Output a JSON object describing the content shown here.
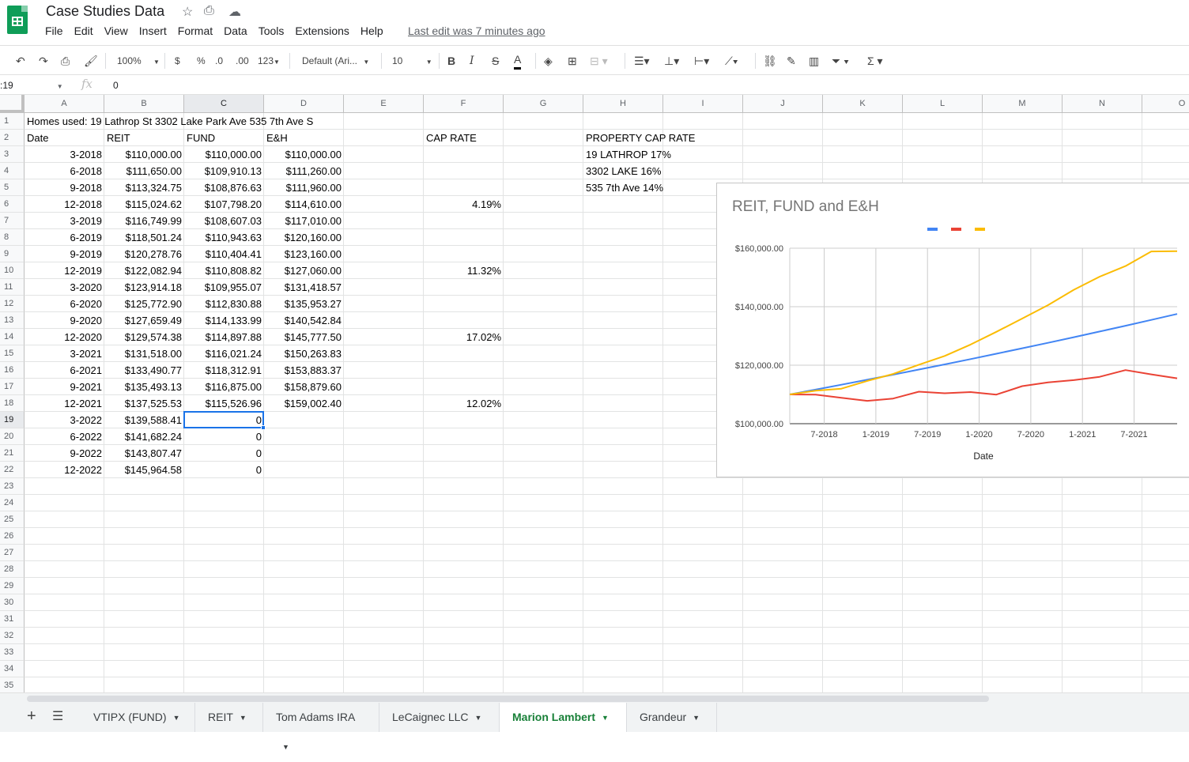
{
  "app": {
    "doc_title": "Case Studies Data",
    "menu": [
      "File",
      "Edit",
      "View",
      "Insert",
      "Format",
      "Data",
      "Tools",
      "Extensions",
      "Help"
    ],
    "last_edit": "Last edit was 7 minutes ago"
  },
  "toolbar": {
    "zoom": "100%",
    "currency": "$",
    "percent": "%",
    "decrease_decimal": ".0",
    "increase_decimal": ".00",
    "more_formats": "123",
    "font": "Default (Ari...",
    "font_size": "10",
    "bold": "B",
    "italic": "I",
    "strike": "S",
    "text_color": "A",
    "text_color_value": "#000000"
  },
  "formula_bar": {
    "name_box": ":19",
    "fx": "fx",
    "value": "0"
  },
  "columns": [
    "A",
    "B",
    "C",
    "D",
    "E",
    "F",
    "G",
    "H",
    "I",
    "J",
    "K",
    "L",
    "M",
    "N",
    "O"
  ],
  "rows": [
    "1",
    "2",
    "3",
    "4",
    "5",
    "6",
    "7",
    "8",
    "9",
    "10",
    "11",
    "12",
    "13",
    "14",
    "15",
    "16",
    "17",
    "18",
    "19",
    "20",
    "21",
    "22",
    "23",
    "24",
    "25",
    "26",
    "27",
    "28",
    "29",
    "30",
    "31",
    "32",
    "33",
    "34",
    "35"
  ],
  "cells": {
    "a1": "Homes used: 19 Lathrop St 3302 Lake Park Ave 535 7th Ave S",
    "headers": {
      "date": "Date",
      "reit": "REIT",
      "fund": "FUND",
      "eh": "E&H",
      "cap_rate": "CAP RATE",
      "property_cap_rate": "PROPERTY CAP RATE"
    },
    "table": [
      [
        "3-2018",
        "$110,000.00",
        "$110,000.00",
        "$110,000.00"
      ],
      [
        "6-2018",
        "$111,650.00",
        "$109,910.13",
        "$111,260.00"
      ],
      [
        "9-2018",
        "$113,324.75",
        "$108,876.63",
        "$111,960.00"
      ],
      [
        "12-2018",
        "$115,024.62",
        "$107,798.20",
        "$114,610.00"
      ],
      [
        "3-2019",
        "$116,749.99",
        "$108,607.03",
        "$117,010.00"
      ],
      [
        "6-2019",
        "$118,501.24",
        "$110,943.63",
        "$120,160.00"
      ],
      [
        "9-2019",
        "$120,278.76",
        "$110,404.41",
        "$123,160.00"
      ],
      [
        "12-2019",
        "$122,082.94",
        "$110,808.82",
        "$127,060.00"
      ],
      [
        "3-2020",
        "$123,914.18",
        "$109,955.07",
        "$131,418.57"
      ],
      [
        "6-2020",
        "$125,772.90",
        "$112,830.88",
        "$135,953.27"
      ],
      [
        "9-2020",
        "$127,659.49",
        "$114,133.99",
        "$140,542.84"
      ],
      [
        "12-2020",
        "$129,574.38",
        "$114,897.88",
        "$145,777.50"
      ],
      [
        "3-2021",
        "$131,518.00",
        "$116,021.24",
        "$150,263.83"
      ],
      [
        "6-2021",
        "$133,490.77",
        "$118,312.91",
        "$153,883.37"
      ],
      [
        "9-2021",
        "$135,493.13",
        "$116,875.00",
        "$158,879.60"
      ],
      [
        "12-2021",
        "$137,525.53",
        "$115,526.96",
        "$159,002.40"
      ],
      [
        "3-2022",
        "$139,588.41",
        "0",
        ""
      ],
      [
        "6-2022",
        "$141,682.24",
        "0",
        ""
      ],
      [
        "9-2022",
        "$143,807.47",
        "0",
        ""
      ],
      [
        "12-2022",
        "$145,964.58",
        "0",
        ""
      ]
    ],
    "cap_rates": [
      {
        "row": 6,
        "value": "4.19%"
      },
      {
        "row": 10,
        "value": "11.32%"
      },
      {
        "row": 14,
        "value": "17.02%"
      },
      {
        "row": 18,
        "value": "12.02%"
      }
    ],
    "property_caps": [
      "19 LATHROP 17%",
      "3302 LAKE 16%",
      "535 7th Ave 14%"
    ]
  },
  "chart_data": {
    "type": "line",
    "title": "REIT, FUND and E&H",
    "xlabel": "Date",
    "ylabel": "",
    "x": [
      "3-2018",
      "6-2018",
      "9-2018",
      "12-2018",
      "3-2019",
      "6-2019",
      "9-2019",
      "12-2019",
      "3-2020",
      "6-2020",
      "9-2020",
      "12-2020",
      "3-2021",
      "6-2021",
      "9-2021",
      "12-2021"
    ],
    "x_ticks": [
      "7-2018",
      "1-2019",
      "7-2019",
      "1-2020",
      "7-2020",
      "1-2021",
      "7-2021"
    ],
    "y_ticks": [
      "$100,000.00",
      "$120,000.00",
      "$140,000.00",
      "$160,000.00"
    ],
    "ylim": [
      100000,
      160000
    ],
    "legend_position": "top",
    "series": [
      {
        "color": "#4285f4",
        "values": [
          110000,
          111650,
          113324.75,
          115024.62,
          116749.99,
          118501.24,
          120278.76,
          122082.94,
          123914.18,
          125772.9,
          127659.49,
          129574.38,
          131518,
          133490.77,
          135493.13,
          137525.53
        ]
      },
      {
        "color": "#ea4335",
        "values": [
          110000,
          109910.13,
          108876.63,
          107798.2,
          108607.03,
          110943.63,
          110404.41,
          110808.82,
          109955.07,
          112830.88,
          114133.99,
          114897.88,
          116021.24,
          118312.91,
          116875,
          115526.96
        ]
      },
      {
        "color": "#fbbc04",
        "values": [
          110000,
          111260,
          111960,
          114610,
          117010,
          120160,
          123160,
          127060,
          131418.57,
          135953.27,
          140542.84,
          145777.5,
          150263.83,
          153883.37,
          158879.6,
          159002.4
        ]
      }
    ]
  },
  "tabs": [
    {
      "label": "VTIPX (FUND)",
      "active": false
    },
    {
      "label": "REIT",
      "active": false
    },
    {
      "label": "Tom Adams IRA",
      "active": false
    },
    {
      "label": "LeCaignec LLC",
      "active": false
    },
    {
      "label": "Marion Lambert",
      "active": true
    },
    {
      "label": "Grandeur",
      "active": false
    }
  ]
}
